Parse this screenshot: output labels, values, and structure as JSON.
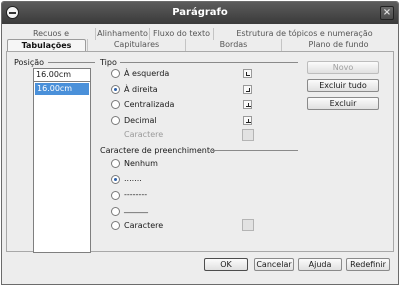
{
  "window": {
    "title": "Parágrafo"
  },
  "tabs": {
    "row1": [
      "Recuos e espaçamento",
      "Alinhamento",
      "Fluxo do texto",
      "Estrutura de tópicos e numeração"
    ],
    "row2": [
      "Tabulações",
      "Capitulares",
      "Bordas",
      "Plano de fundo"
    ],
    "active": "Tabulações"
  },
  "position": {
    "label": "Posição",
    "value": "16.00cm",
    "list": [
      "16.00cm"
    ]
  },
  "type_group": {
    "label": "Tipo",
    "options": [
      "À esquerda",
      "À direita",
      "Centralizada",
      "Decimal"
    ],
    "selected": "À direita",
    "character_label": "Caractere"
  },
  "fill_group": {
    "label": "Caractere de preenchimento",
    "options": [
      "Nenhum",
      ".......",
      "--------",
      "______",
      "Caractere"
    ],
    "selected": "......."
  },
  "side_buttons": {
    "new": "Novo",
    "delete_all": "Excluir tudo",
    "delete": "Excluir"
  },
  "footer_buttons": {
    "ok": "OK",
    "cancel": "Cancelar",
    "help": "Ajuda",
    "reset": "Redefinir"
  }
}
